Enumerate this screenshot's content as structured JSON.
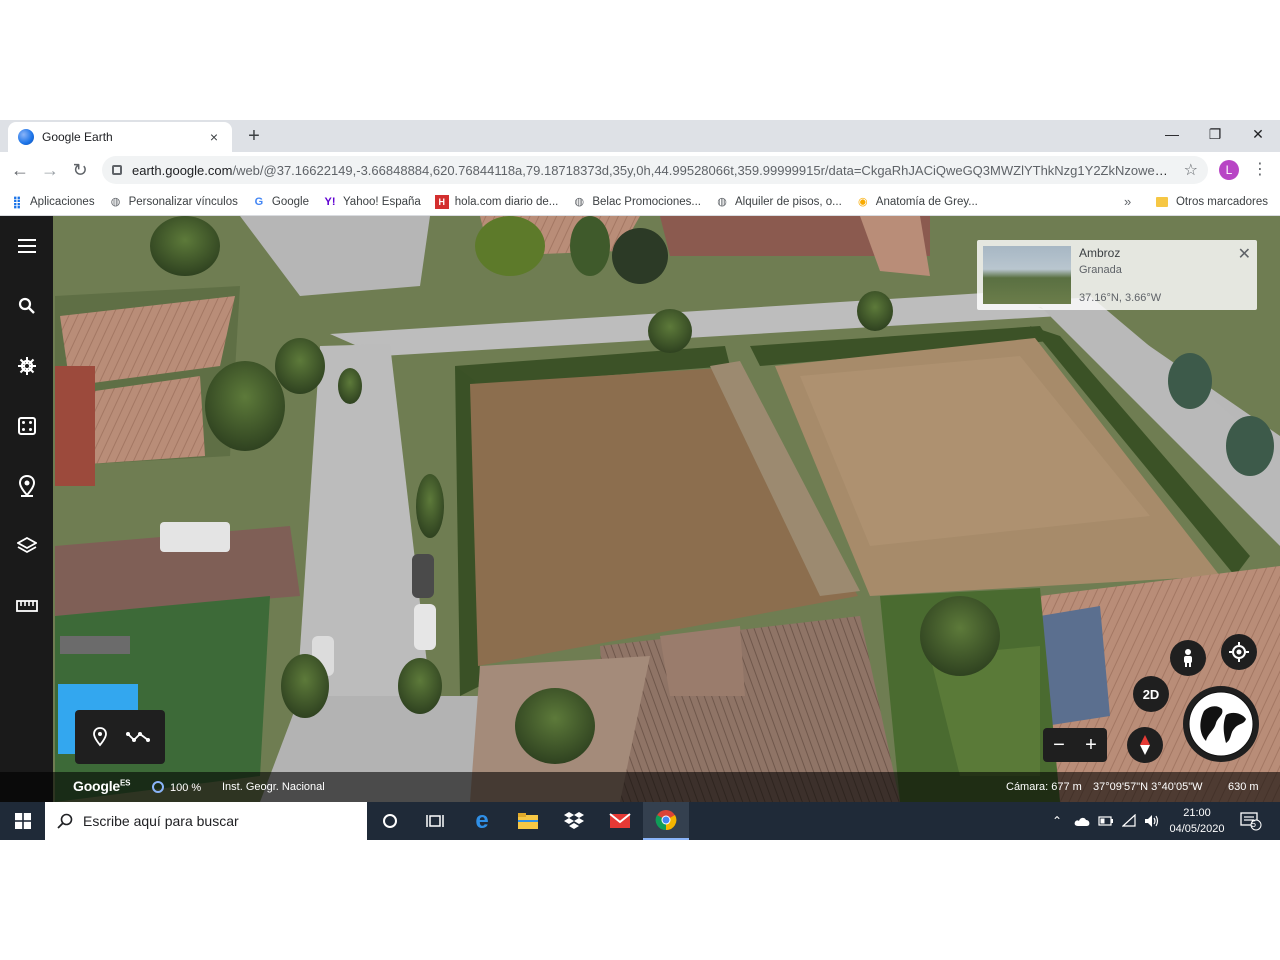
{
  "browser": {
    "tab_title": "Google Earth",
    "tab_close": "×",
    "new_tab": "+",
    "window_controls": {
      "minimize": "—",
      "restore": "❐",
      "close": "✕"
    },
    "url_host": "earth.google.com",
    "url_rest": "/web/@37.16622149,-3.66848884,620.76844118a,79.18718373d,35y,0h,44.99528066t,359.99999915r/data=CkgaRhJACiQweGQ3MWZlYThkNzg1Y2ZkNzoweDI2...",
    "profile_initial": "L",
    "bookmarks": [
      {
        "label": "Aplicaciones",
        "icon": "apps-grid-icon"
      },
      {
        "label": "Personalizar vínculos",
        "icon": "globe-icon"
      },
      {
        "label": "Google",
        "icon": "google-g-icon"
      },
      {
        "label": "Yahoo! España",
        "icon": "yahoo-icon"
      },
      {
        "label": "hola.com diario de...",
        "icon": "hola-icon"
      },
      {
        "label": "Belac Promociones...",
        "icon": "globe-icon"
      },
      {
        "label": "Alquiler de pisos, o...",
        "icon": "globe-icon"
      },
      {
        "label": "Anatomía de Grey...",
        "icon": "fan-site-icon"
      }
    ],
    "bookmarks_overflow": "»",
    "other_bookmarks": "Otros marcadores"
  },
  "earth": {
    "place_card": {
      "name": "Ambroz",
      "region": "Granada",
      "coords": "37.16°N, 3.66°W",
      "close": "✕"
    },
    "status": {
      "logo": "Google",
      "logo_lang": "ES",
      "progress": "100 %",
      "attribution": "Inst. Geogr. Nacional",
      "camera": "Cámara: 677 m",
      "coordinates": "37°09'57\"N 3°40'05\"W",
      "elevation": "630 m"
    },
    "view_mode_label": "2D",
    "zoom_out": "−",
    "zoom_in": "+"
  },
  "taskbar": {
    "search_placeholder": "Escribe aquí para buscar",
    "time": "21:00",
    "date": "04/05/2020",
    "notifications_count": "5"
  },
  "colors": {
    "chrome_tabstrip": "#dee1e6",
    "earth_rail": "#1a1a1a",
    "taskbar": "#1f2a38",
    "accent": "#1a73e8"
  }
}
